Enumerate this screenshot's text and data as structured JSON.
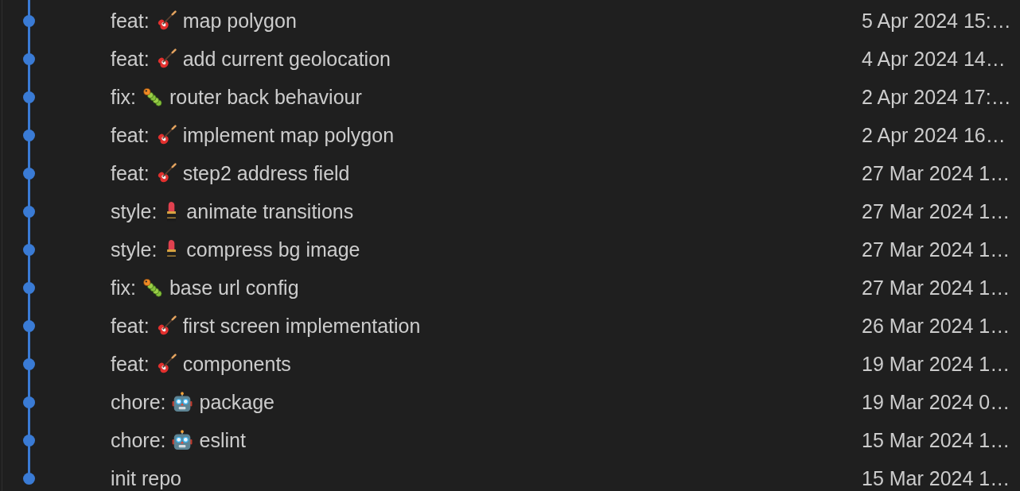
{
  "commits": [
    {
      "type": "feat:",
      "kind": "feature",
      "message": "map polygon",
      "date": "5 Apr 2024 15:…"
    },
    {
      "type": "feat:",
      "kind": "feature",
      "message": "add current geolocation",
      "date": "4 Apr 2024 14…"
    },
    {
      "type": "fix:",
      "kind": "fix",
      "message": "router back behaviour",
      "date": "2 Apr 2024 17:…"
    },
    {
      "type": "feat:",
      "kind": "feature",
      "message": "implement map polygon",
      "date": "2 Apr 2024 16…"
    },
    {
      "type": "feat:",
      "kind": "feature",
      "message": "step2 address field",
      "date": "27 Mar 2024 1…"
    },
    {
      "type": "style:",
      "kind": "style",
      "message": "animate transitions",
      "date": "27 Mar 2024 1…"
    },
    {
      "type": "style:",
      "kind": "style",
      "message": "compress bg image",
      "date": "27 Mar 2024 1…"
    },
    {
      "type": "fix:",
      "kind": "fix",
      "message": "base url config",
      "date": "27 Mar 2024 1…"
    },
    {
      "type": "feat:",
      "kind": "feature",
      "message": "first screen implementation",
      "date": "26 Mar 2024 1…"
    },
    {
      "type": "feat:",
      "kind": "feature",
      "message": "components",
      "date": "19 Mar 2024 1…"
    },
    {
      "type": "chore:",
      "kind": "chore",
      "message": "package",
      "date": "19 Mar 2024 0…"
    },
    {
      "type": "chore:",
      "kind": "chore",
      "message": "eslint",
      "date": "15 Mar 2024 1…"
    },
    {
      "kind": "plain",
      "message": "init repo",
      "date": "15 Mar 2024 1…"
    }
  ]
}
